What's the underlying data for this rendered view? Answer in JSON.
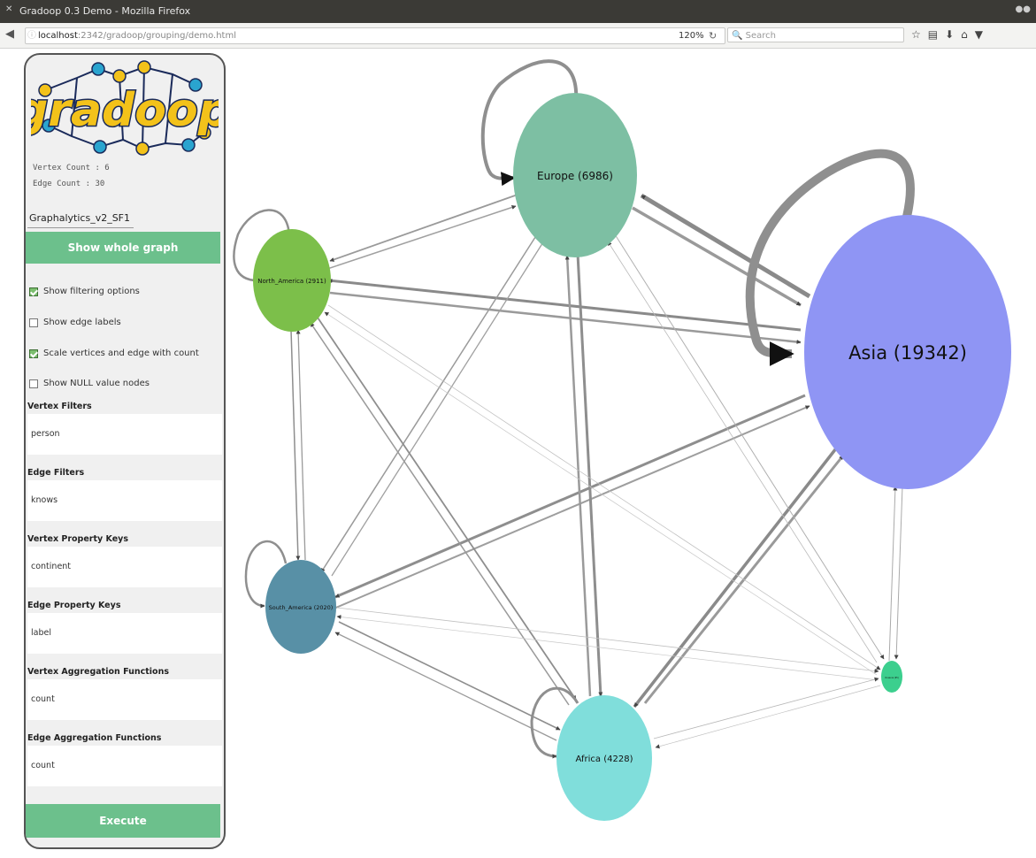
{
  "window": {
    "title": "Gradoop 0.3 Demo - Mozilla Firefox"
  },
  "browser": {
    "url_host": "localhost",
    "url_path": ":2342/gradoop/grouping/demo.html",
    "zoom": "120%",
    "search_placeholder": "Search"
  },
  "sidebar": {
    "logo_text": "gradoop",
    "vertex_count": "Vertex Count : 6",
    "edge_count": "Edge Count   : 30",
    "dataset": "Graphalytics_v2_SF1",
    "show_whole_graph": "Show whole graph",
    "options": [
      {
        "label": "Show filtering options",
        "checked": true
      },
      {
        "label": "Show edge labels",
        "checked": false
      },
      {
        "label": "Scale vertices and edge with count",
        "checked": true
      },
      {
        "label": "Show NULL value nodes",
        "checked": false
      }
    ],
    "sections": [
      {
        "label": "Vertex Filters",
        "value": "person"
      },
      {
        "label": "Edge Filters",
        "value": "knows"
      },
      {
        "label": "Vertex Property Keys",
        "value": "continent"
      },
      {
        "label": "Edge Property Keys",
        "value": "label"
      },
      {
        "label": "Vertex Aggregation Functions",
        "value": "count"
      },
      {
        "label": "Edge Aggregation Functions",
        "value": "count"
      }
    ],
    "execute": "Execute"
  },
  "graph": {
    "nodes": [
      {
        "id": "asia",
        "label": "Asia (19342)",
        "count": 19342,
        "color": "#8f95f4"
      },
      {
        "id": "europe",
        "label": "Europe (6986)",
        "count": 6986,
        "color": "#7dbfa3"
      },
      {
        "id": "north_america",
        "label": "North_America (2911)",
        "count": 2911,
        "color": "#7cbf4a"
      },
      {
        "id": "south_america",
        "label": "South_America (2020)",
        "count": 2020,
        "color": "#5890a6"
      },
      {
        "id": "africa",
        "label": "Africa (4228)",
        "count": 4228,
        "color": "#80dedb"
      },
      {
        "id": "oceania",
        "label": "Oceania (95)",
        "count": 95,
        "color": "#3ccf8e"
      }
    ]
  }
}
